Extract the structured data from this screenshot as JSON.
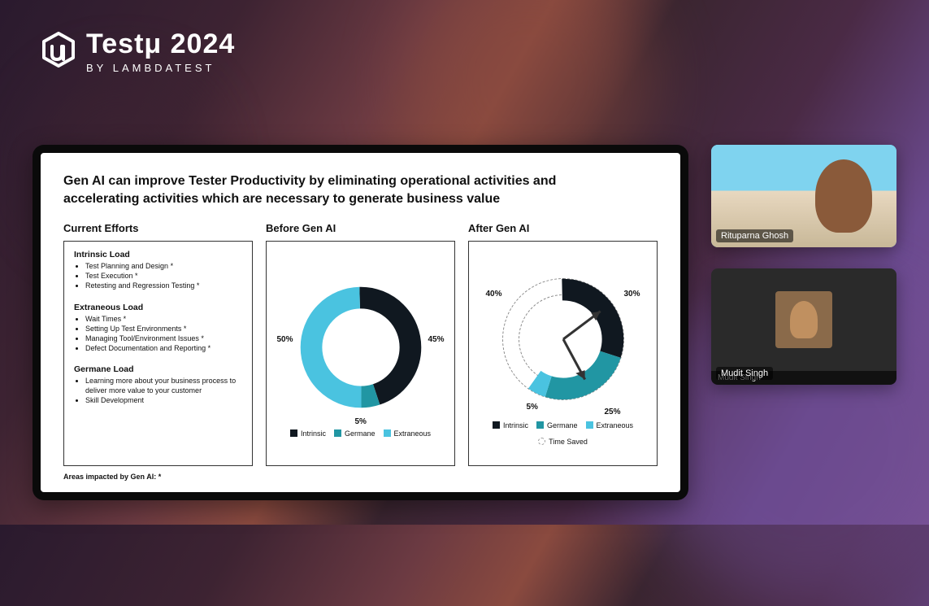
{
  "branding": {
    "title": "Testμ 2024",
    "subtitle": "BY LAMBDATEST"
  },
  "slide": {
    "title": "Gen AI can improve Tester Productivity by eliminating operational activities and accelerating activities which are necessary to generate business value",
    "col1_title": "Current Efforts",
    "col2_title": "Before Gen AI",
    "col3_title": "After Gen AI",
    "intrinsic_heading": "Intrinsic Load",
    "intrinsic_items": [
      "Test Planning and Design *",
      "Test Execution *",
      "Retesting and Regression Testing *"
    ],
    "extraneous_heading": "Extraneous Load",
    "extraneous_items": [
      "Wait Times *",
      "Setting Up Test Environments *",
      "Managing Tool/Environment Issues *",
      "Defect Documentation and Reporting *"
    ],
    "germane_heading": "Germane Load",
    "germane_items": [
      "Learning more about your business process to deliver more value to your customer",
      "Skill Development"
    ],
    "legend_intrinsic": "Intrinsic",
    "legend_germane": "Germane",
    "legend_extraneous": "Extraneous",
    "legend_timesaved": "Time Saved",
    "footnote": "Areas impacted by Gen AI: *"
  },
  "chart_data": [
    {
      "type": "pie",
      "title": "Before Gen AI",
      "series": [
        {
          "name": "Intrinsic",
          "value": 45,
          "color": "#101820"
        },
        {
          "name": "Germane",
          "value": 5,
          "color": "#2196a3"
        },
        {
          "name": "Extraneous",
          "value": 50,
          "color": "#4ac3e0"
        }
      ],
      "labels": {
        "intrinsic": "45%",
        "germane": "5%",
        "extraneous": "50%"
      }
    },
    {
      "type": "pie",
      "title": "After Gen AI",
      "series": [
        {
          "name": "Intrinsic",
          "value": 30,
          "color": "#101820"
        },
        {
          "name": "Germane",
          "value": 25,
          "color": "#2196a3"
        },
        {
          "name": "Extraneous",
          "value": 5,
          "color": "#4ac3e0"
        },
        {
          "name": "Time Saved",
          "value": 40,
          "color": "dashed"
        }
      ],
      "labels": {
        "intrinsic": "30%",
        "germane": "25%",
        "extraneous": "5%",
        "timesaved": "40%"
      }
    }
  ],
  "participants": [
    {
      "name": "Rituparna Ghosh",
      "caption": null,
      "active": true
    },
    {
      "name": "Mudit Singh",
      "caption": "Mudit Singh",
      "active": false
    }
  ]
}
